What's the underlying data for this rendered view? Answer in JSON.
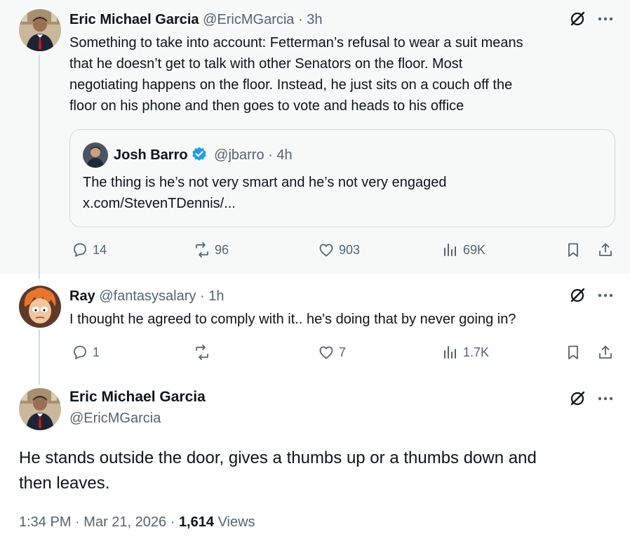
{
  "tweet1": {
    "name": "Eric Michael Garcia",
    "handle": "@EricMGarcia",
    "sep": "·",
    "time": "3h",
    "lines": [
      "Something to take into account: Fetterman’s refusal to wear a suit means",
      "that he doesn’t get to talk with other Senators on the floor. Most",
      "negotiating happens on the floor. Instead, he just sits on a couch off the",
      "floor on his phone and then goes to vote and heads to his office"
    ],
    "quote": {
      "name": "Josh Barro",
      "handle": "@jbarro",
      "sep": "·",
      "time": "4h",
      "text": "The thing is he’s not very smart and he’s not very engaged",
      "link": "x.com/StevenTDennis/..."
    },
    "replies": "14",
    "reposts": "96",
    "likes": "903",
    "views": "69K"
  },
  "tweet2": {
    "name": "Ray",
    "handle": "@fantasysalary",
    "sep": "·",
    "time": "1h",
    "text": "I thought he agreed to comply with it.. he's doing that by never going in?",
    "replies": "1",
    "reposts": "",
    "likes": "7",
    "views": "1.7K"
  },
  "main": {
    "name": "Eric Michael Garcia",
    "handle": "@EricMGarcia",
    "text_lines": [
      "He stands outside the door, gives a thumbs up or a thumbs down and",
      "then leaves."
    ],
    "time": "1:34 PM",
    "sep1": "·",
    "date": "Mar 21, 2026",
    "sep2": "·",
    "views_count": "1,614",
    "views_label": "Views"
  },
  "icons": {
    "grok": "grok-icon",
    "more": "more-icon",
    "reply": "reply-icon",
    "repost": "repost-icon",
    "like": "like-icon",
    "views": "views-icon",
    "bookmark": "bookmark-icon",
    "share": "share-icon",
    "verified": "verified-badge-icon"
  },
  "colors": {
    "muted": "#536471",
    "text": "#0f1419",
    "verified": "#1d9bf0",
    "highlight_bg": "#f7f9f9",
    "thread_line": "#cfd9de"
  }
}
